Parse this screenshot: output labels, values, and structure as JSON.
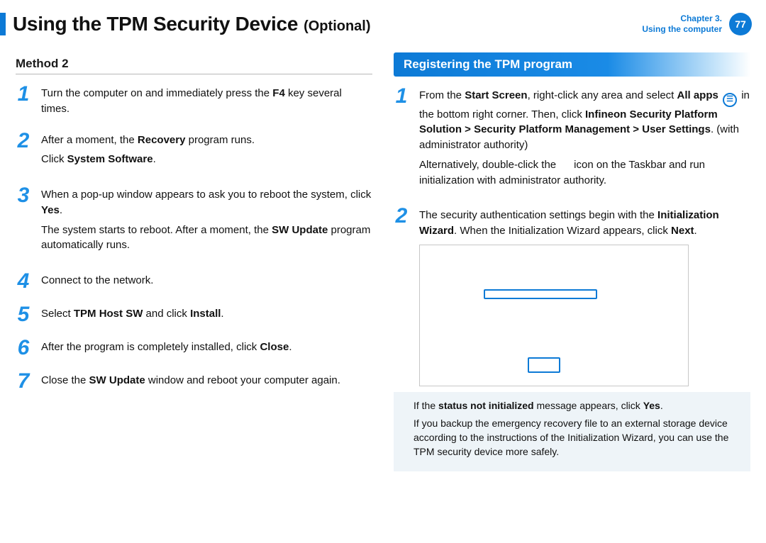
{
  "header": {
    "title_main": "Using the TPM Security Device",
    "title_opt": "(Optional)",
    "chapter_line1": "Chapter 3.",
    "chapter_line2": "Using the computer",
    "page_no": "77"
  },
  "left": {
    "method_h": "Method 2",
    "steps": [
      {
        "n": "1",
        "html": "Turn the computer on and immediately press the <b>F4</b> key several times."
      },
      {
        "n": "2",
        "html": "After a moment, the <b>Recovery</b> program runs.<p class='sub'>Click <b>System Software</b>.</p>"
      },
      {
        "n": "3",
        "html": "When a pop-up window appears to ask you to reboot the system, click <b>Yes</b>.<p class='sub'>The system starts to reboot. After a moment, the <b>SW Update</b> program automatically runs.</p>"
      },
      {
        "n": "4",
        "html": "Connect to the network."
      },
      {
        "n": "5",
        "html": "Select <b>TPM Host SW</b> and click  <b>Install</b>."
      },
      {
        "n": "6",
        "html": "After the program is completely installed, click <b>Close</b>."
      },
      {
        "n": "7",
        "html": "Close the <b>SW Update</b> window and reboot your computer again."
      }
    ]
  },
  "right": {
    "section_title": "Registering the TPM program",
    "steps": [
      {
        "n": "1",
        "html": "From the <b>Start Screen</b>, right-click any area and select <b>All apps</b> <span class='allapps-icon' data-name='all-apps-icon' data-interactable='false'>☰</span> in the bottom right corner. Then, click <b>Infineon Security Platform Solution &gt; Security Platform Management &gt; User Settings</b>. (with administrator authority)<p class='sub'>Alternatively, double-click the &nbsp;&nbsp;&nbsp;&nbsp; icon on the Taskbar and run initialization with administrator authority.</p>"
      },
      {
        "n": "2",
        "html": "The security authentication settings begin with the <b>Initialization Wizard</b>. When the Initialization Wizard appears, click <b>Next</b>."
      }
    ],
    "note1": "If the <b>status not initialized</b> message appears, click <b>Yes</b>.",
    "note2": "If you backup the emergency recovery file to an external storage device according to the instructions of the Initialization Wizard, you can use the TPM security device more safely."
  }
}
